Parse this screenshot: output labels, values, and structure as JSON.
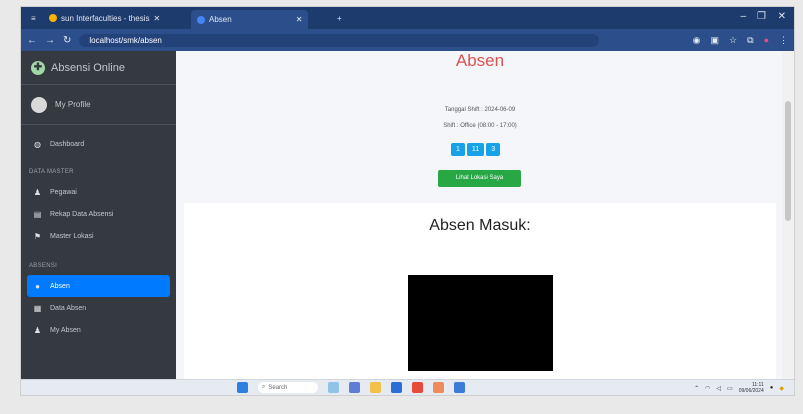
{
  "browser": {
    "tabs": [
      {
        "label": "sun Interfaculties - thesis",
        "color": "#f4b400"
      },
      {
        "label": "Absen",
        "color": "#4285f4"
      }
    ],
    "url": "localhost/smk/absen"
  },
  "sidebar": {
    "brand": "Absensi Online",
    "user": "My Profile",
    "items_top": [
      {
        "label": "Dashboard",
        "icon": "dashboard-icon"
      }
    ],
    "header_master": "DATA MASTER",
    "items_master": [
      {
        "label": "Pegawai",
        "icon": "user-icon"
      },
      {
        "label": "Rekap Data Absensi",
        "icon": "report-icon"
      },
      {
        "label": "Master Lokasi",
        "icon": "location-icon"
      }
    ],
    "header_absen": "ABSENSI",
    "items_absen": [
      {
        "label": "Absen",
        "icon": "camera-icon",
        "active": true
      },
      {
        "label": "Data Absen",
        "icon": "table-icon"
      },
      {
        "label": "My Absen",
        "icon": "user-icon"
      }
    ]
  },
  "main": {
    "title": "Absen",
    "tanggal": "Tanggal Shift : 2024-06-09",
    "shift": "Shift : Office (08:00 - 17:00)",
    "clock": [
      "1",
      "11",
      "3"
    ],
    "lokasi_button": "Lihat Lokasi Saya",
    "card_title": "Absen Masuk:"
  },
  "taskbar": {
    "search_placeholder": "Search",
    "time": "11:11",
    "date": "09/06/2024"
  },
  "colors": {
    "sidebar_bg": "#343a40",
    "accent": "#007bff",
    "title": "#d9534f",
    "success": "#28a745",
    "info": "#17a2e8"
  }
}
